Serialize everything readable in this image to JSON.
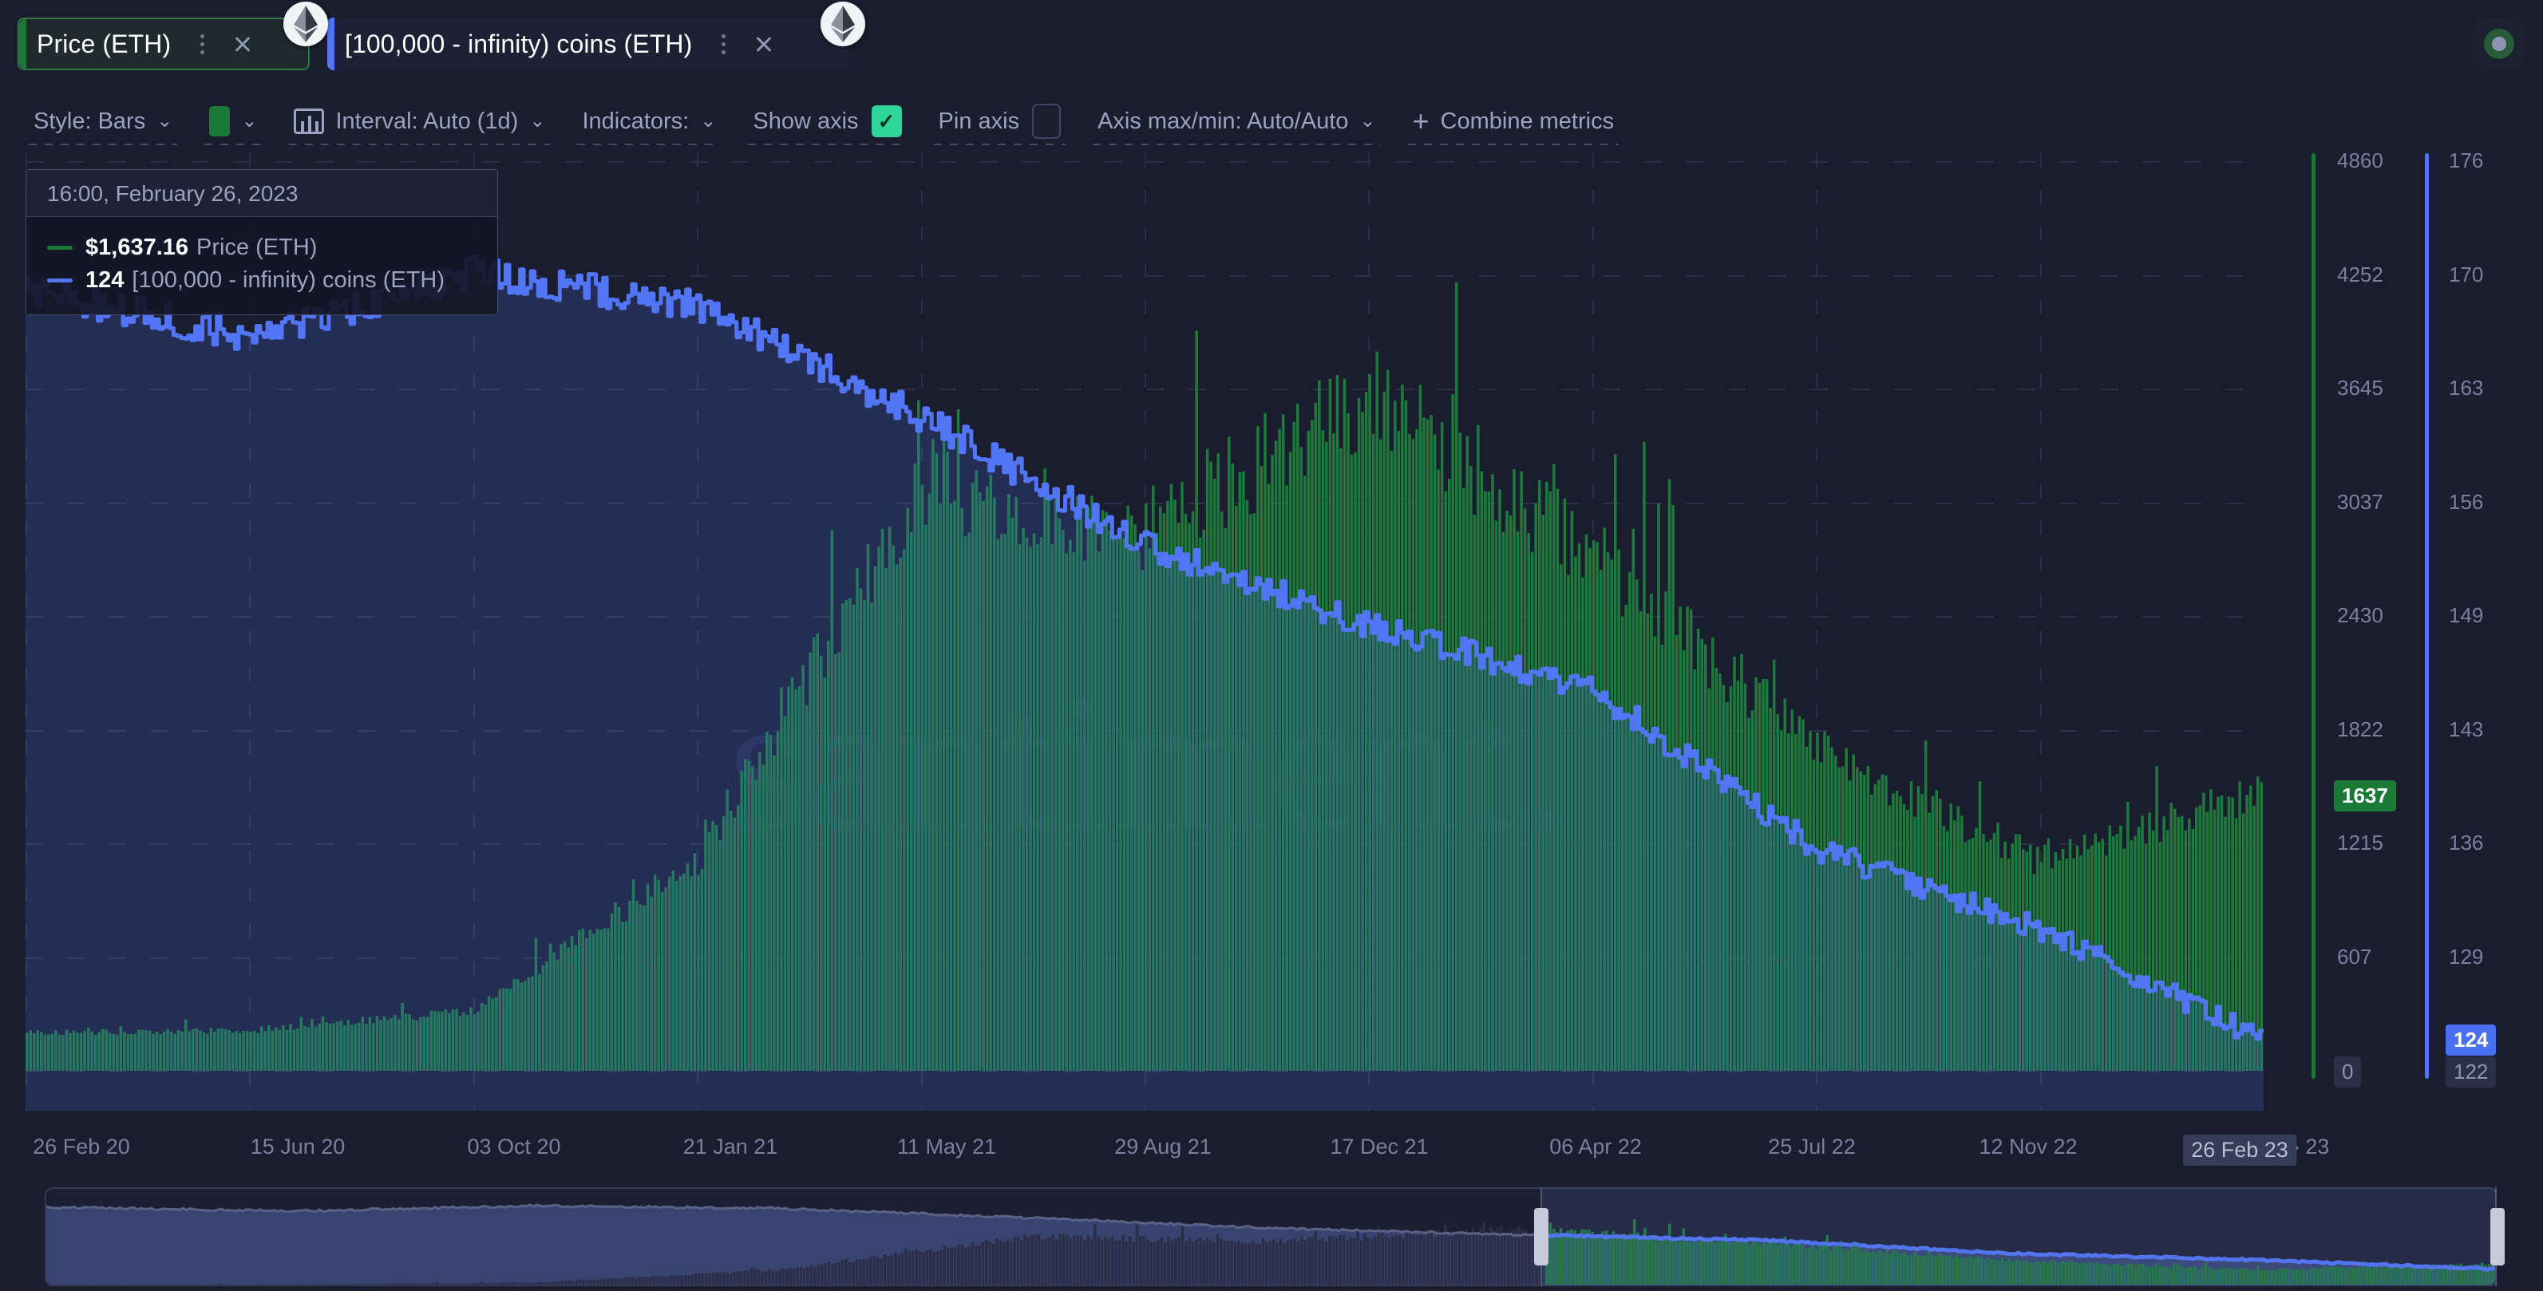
{
  "tabs": [
    {
      "label": "Price (ETH)",
      "accent": "#1a7a35",
      "coin_icon": "ethereum-icon",
      "menu_icon": "kebab-menu-icon",
      "close_icon": "close-icon"
    },
    {
      "label": "[100,000 - infinity) coins (ETH)",
      "accent": "#5275f5",
      "coin_icon": "ethereum-icon",
      "menu_icon": "kebab-menu-icon",
      "close_icon": "close-icon"
    }
  ],
  "toolbar": {
    "style_label": "Style: Bars",
    "color_swatch": "#1a7a35",
    "interval_label": "Interval: Auto (1d)",
    "indicators_label": "Indicators:",
    "show_axis_label": "Show axis",
    "show_axis_checked": true,
    "pin_axis_label": "Pin axis",
    "pin_axis_checked": false,
    "axis_minmax_label": "Axis max/min: Auto/Auto",
    "combine_label": "Combine metrics",
    "plus_glyph": "+",
    "caret_glyph": "⌄"
  },
  "tooltip": {
    "date": "16:00, February 26, 2023",
    "rows": [
      {
        "value": "$1,637.16",
        "name": "Price (ETH)",
        "color": "#1a7a35"
      },
      {
        "value": "124",
        "name": "[100,000  - infinity) coins (ETH)",
        "color": "#5275f5"
      }
    ]
  },
  "watermark": "santiment.",
  "axes": {
    "left_axis_color": "#1a7a35",
    "right_axis_color": "#5275f5",
    "price_ticks": [
      "4860",
      "4252",
      "3645",
      "3037",
      "2430",
      "1822",
      "1215",
      "607",
      "0"
    ],
    "price_current": "1637",
    "price_min_label": "0",
    "holders_ticks": [
      "176",
      "170",
      "163",
      "156",
      "149",
      "143",
      "136",
      "129"
    ],
    "holders_current": "124",
    "holders_min_label": "122"
  },
  "xaxis": {
    "labels": [
      "26 Feb 20",
      "15 Jun 20",
      "03 Oct 20",
      "21 Jan 21",
      "11 May 21",
      "29 Aug 21",
      "17 Dec 21",
      "06 Apr 22",
      "25 Jul 22",
      "12 Nov 22"
    ],
    "cursor_label": "26 Feb 23",
    "trailing_label": "› 23"
  },
  "chart_data": {
    "type": "bar",
    "title": "",
    "xlabel": "",
    "ylabel": "Price (ETH)",
    "y2label": "[100,000 - infinity) coins (ETH)",
    "ylim": [
      0,
      5400
    ],
    "y2lim": [
      122,
      179
    ],
    "grid": true,
    "legend": "tooltip",
    "x": [
      "26 Feb 20",
      "15 Jun 20",
      "03 Oct 20",
      "21 Jan 21",
      "11 May 21",
      "29 Aug 21",
      "17 Dec 21",
      "06 Apr 22",
      "25 Jul 22",
      "12 Nov 22",
      "26 Feb 23"
    ],
    "series": [
      {
        "name": "Price (ETH)",
        "type": "bar",
        "color": "#1e7a3c",
        "axis": "left",
        "values": [
          225,
          238,
          355,
          1250,
          3500,
          3200,
          4000,
          3100,
          1900,
          1250,
          1637
        ]
      },
      {
        "name": "[100,000 - infinity) coins (ETH)",
        "type": "line",
        "color": "#5275f5",
        "axis": "right",
        "values": [
          171,
          168,
          172,
          170,
          163,
          155,
          150,
          146,
          136,
          131,
          124
        ]
      }
    ],
    "annotations": [
      {
        "text": "$1,637.16",
        "series": "Price (ETH)",
        "at": "26 Feb 23"
      },
      {
        "text": "124",
        "series": "[100,000 - infinity) coins (ETH)",
        "at": "26 Feb 23"
      }
    ]
  }
}
